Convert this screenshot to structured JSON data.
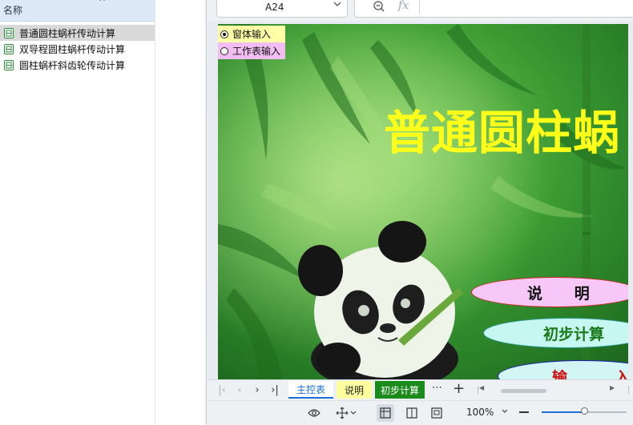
{
  "file_panel": {
    "header_label": "名称",
    "sort_icon": "chevron-up-icon",
    "items": [
      {
        "label": "普通圆柱蜗杆传动计算",
        "icon": "spreadsheet-file-icon",
        "selected": true
      },
      {
        "label": "双导程圆柱蜗杆传动计算",
        "icon": "spreadsheet-file-icon",
        "selected": false
      },
      {
        "label": "圆柱蜗杆斜齿轮传动计算",
        "icon": "spreadsheet-file-icon",
        "selected": false
      }
    ]
  },
  "formula_bar": {
    "cell_ref": "A24",
    "fx_label": "fx",
    "formula_value": ""
  },
  "sheet": {
    "input_mode_options": [
      {
        "label": "窗体输入",
        "checked": true
      },
      {
        "label": "工作表输入",
        "checked": false
      }
    ],
    "title": "普通圆柱蜗",
    "buttons": [
      {
        "label": "说      明"
      },
      {
        "label": "初步计算"
      },
      {
        "label": "输         入"
      }
    ],
    "colors": {
      "background": "#2e8b2e",
      "title": "#ffff1a"
    }
  },
  "tabs": {
    "sheets": [
      {
        "label": "主控表",
        "active": true,
        "color": "#ffffff"
      },
      {
        "label": "说明",
        "active": false,
        "color": "#ffffa0"
      },
      {
        "label": "初步计算",
        "active": false,
        "color": "#1a8a1a"
      }
    ],
    "more_label": "⋯",
    "add_label": "+"
  },
  "status_bar": {
    "zoom": "100%",
    "zoom_level": 0.5,
    "icons": [
      "eye-icon",
      "move-icon",
      "normal-view-icon",
      "page-layout-icon",
      "page-break-icon"
    ]
  }
}
